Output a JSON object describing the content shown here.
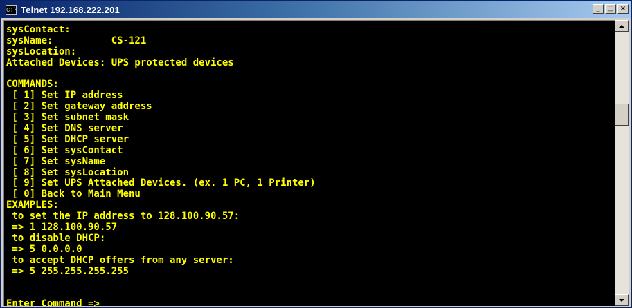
{
  "window": {
    "title": "Telnet 192.168.222.201",
    "app_icon": "C:\\",
    "controls": {
      "minimize": "_",
      "maximize": "□",
      "close": "×"
    }
  },
  "console": {
    "lines": [
      "sysContact:",
      "sysName:          CS-121",
      "sysLocation:",
      "Attached Devices: UPS protected devices",
      "",
      "COMMANDS:",
      " [ 1] Set IP address",
      " [ 2] Set gateway address",
      " [ 3] Set subnet mask",
      " [ 4] Set DNS server",
      " [ 5] Set DHCP server",
      " [ 6] Set sysContact",
      " [ 7] Set sysName",
      " [ 8] Set sysLocation",
      " [ 9] Set UPS Attached Devices. (ex. 1 PC, 1 Printer)",
      " [ 0] Back to Main Menu",
      "EXAMPLES:",
      " to set the IP address to 128.100.90.57:",
      " => 1 128.100.90.57",
      " to disable DHCP:",
      " => 5 0.0.0.0",
      " to accept DHCP offers from any server:",
      " => 5 255.255.255.255",
      "",
      ""
    ],
    "prompt": "Enter Command => ",
    "text_color": "#ffff00",
    "background": "#000000"
  },
  "scrollbar": {
    "position": 0.3
  }
}
